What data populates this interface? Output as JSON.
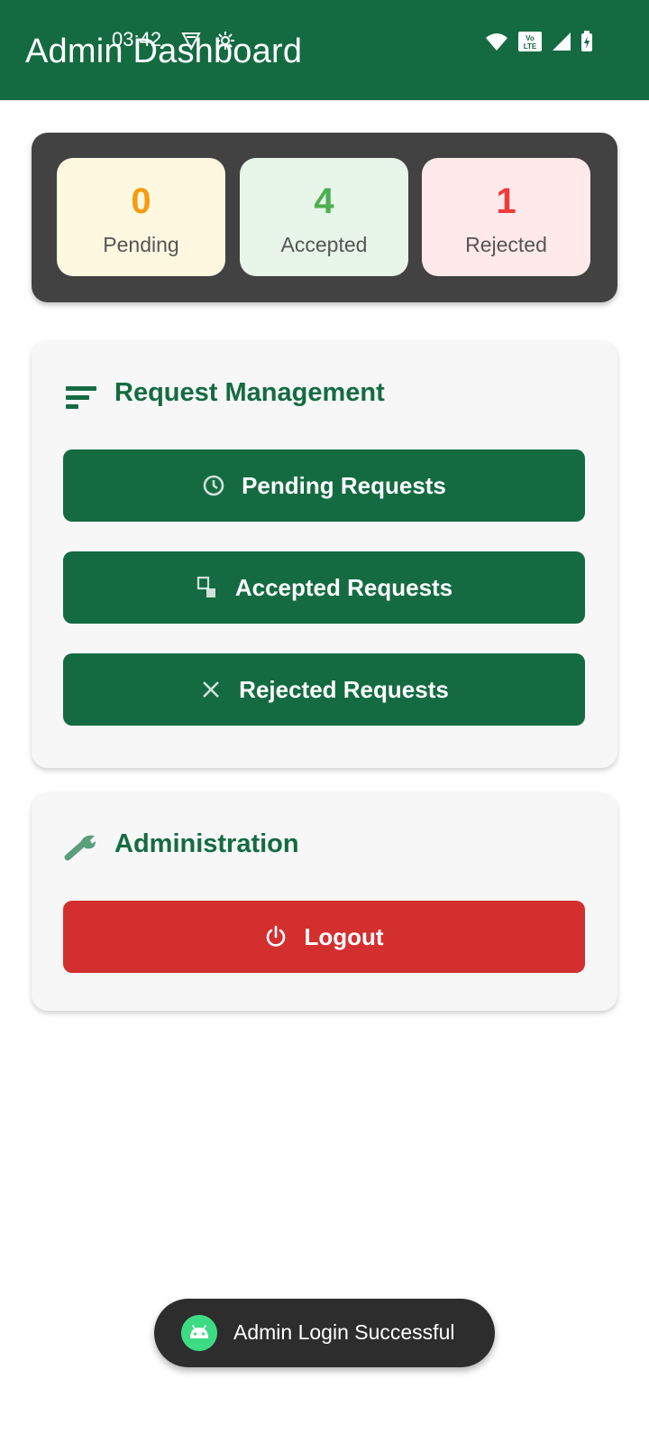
{
  "status_bar": {
    "time": "03:42"
  },
  "app_bar": {
    "title": "Admin Dashboard",
    "color": "#146b42"
  },
  "stats": [
    {
      "value": "0",
      "label": "Pending",
      "color": "#f39c12"
    },
    {
      "value": "4",
      "label": "Accepted",
      "color": "#4caf50"
    },
    {
      "value": "1",
      "label": "Rejected",
      "color": "#ee3b3b"
    }
  ],
  "request_management": {
    "title": "Request Management",
    "icon": "sort-lines-icon",
    "buttons": [
      {
        "label": "Pending Requests",
        "icon": "clock-icon"
      },
      {
        "label": "Accepted Requests",
        "icon": "document-icon"
      },
      {
        "label": "Rejected Requests",
        "icon": "close-icon"
      }
    ]
  },
  "administration": {
    "title": "Administration",
    "icon": "wrench-icon",
    "logout_label": "Logout",
    "logout_icon": "power-icon",
    "logout_color": "#d32f2f"
  },
  "toast": {
    "message": "Admin Login Successful",
    "icon": "android-icon"
  }
}
